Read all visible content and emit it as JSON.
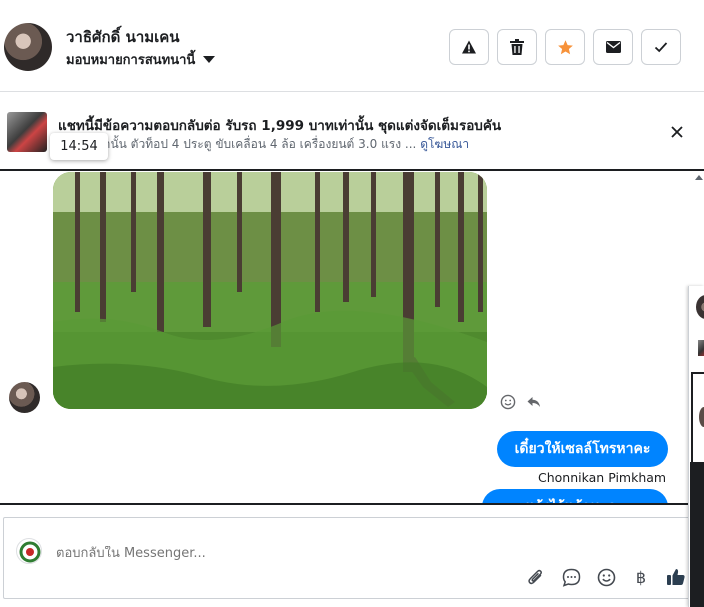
{
  "header": {
    "contact_name": "วาธิศักดิ์ นามเคน",
    "assign_label": "มอบหมายการสนทนานี้",
    "actions": [
      {
        "name": "report-button",
        "icon": "warning-icon"
      },
      {
        "name": "delete-button",
        "icon": "trash-icon"
      },
      {
        "name": "star-button",
        "icon": "star-icon"
      },
      {
        "name": "mark-unread-button",
        "icon": "envelope-icon"
      },
      {
        "name": "done-button",
        "icon": "check-icon"
      }
    ]
  },
  "ad": {
    "title": "แชทนี้มีข้อความตอบกลับต่อ รับรถ 1,999 บาทเท่านั้น ชุดแต่งจัดเต็มรอบคัน",
    "description": "9 บาทเท่านั้น ตัวท็อป 4 ประตู ขับเคลื่อน 4 ล้อ เครื่องยนต์ 3.0 แรง ...",
    "link": "ดูโฆษณา"
  },
  "tooltip_time": "14:54",
  "messages": {
    "bubble1": "เดี๋ยวให้เซลล์โทรหาคะ",
    "sender": "Chonnikan Pimkham",
    "bubble2": "แจ้งไว้แล้วนะคะ"
  },
  "composer": {
    "placeholder": "ตอบกลับใน Messenger...",
    "currency_symbol": "฿"
  },
  "colors": {
    "accent": "#0084ff",
    "star": "#f7923a",
    "link": "#385898"
  }
}
